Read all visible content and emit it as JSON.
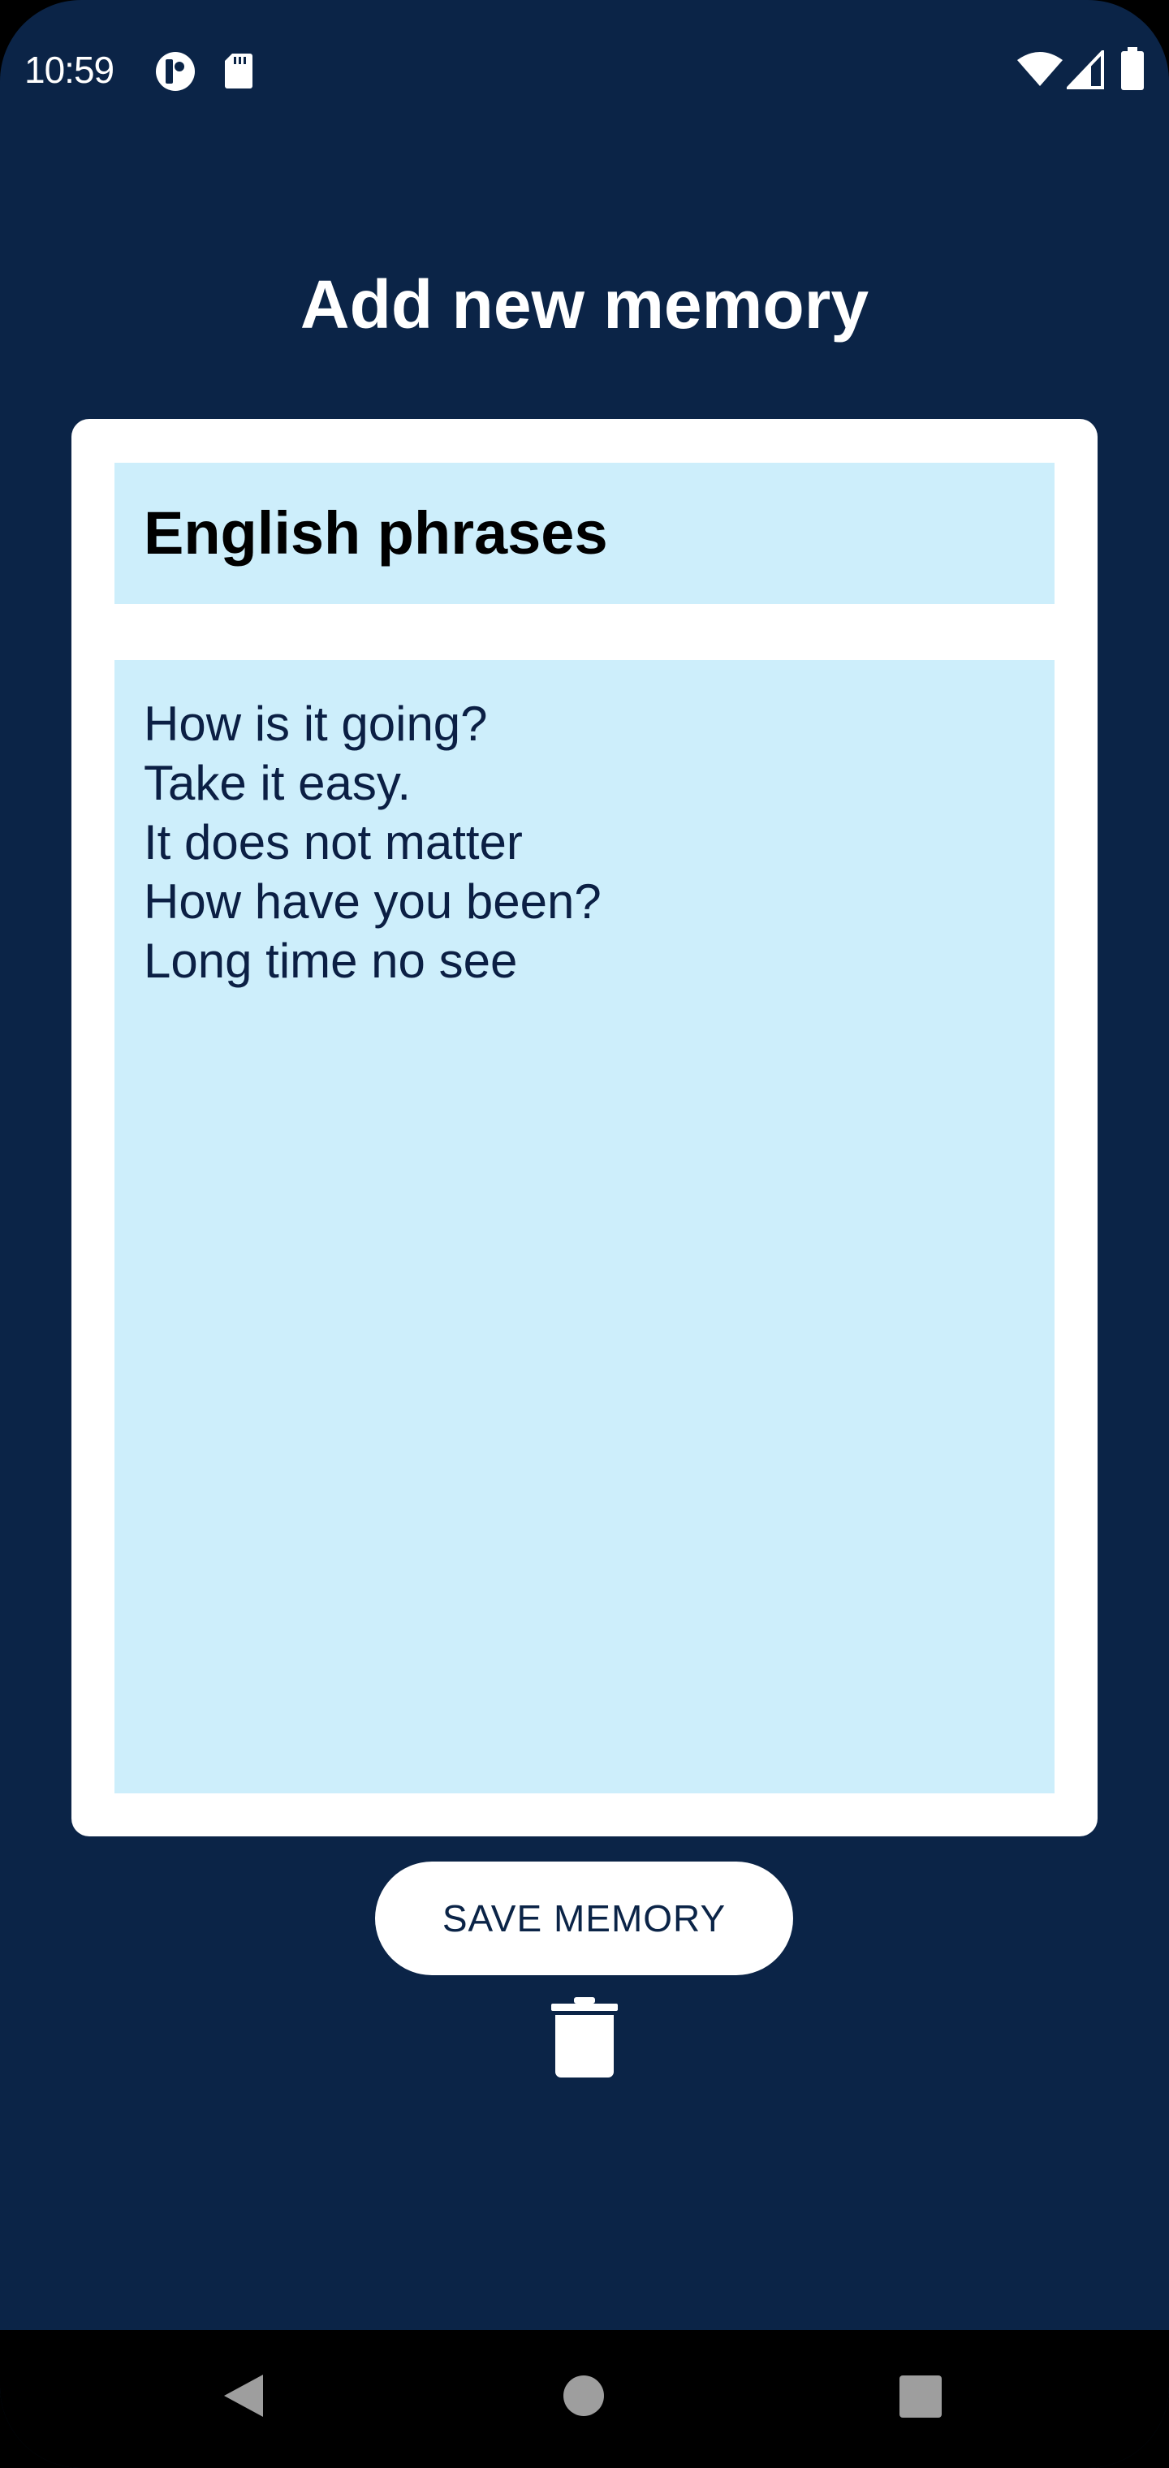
{
  "status_bar": {
    "time": "10:59",
    "left_icons": [
      "app-indicator-icon",
      "sd-card-icon"
    ],
    "right_icons": [
      "wifi-icon",
      "cell-signal-icon",
      "battery-icon"
    ]
  },
  "page": {
    "title": "Add new memory"
  },
  "memory_form": {
    "title_value": "English phrases",
    "body_lines": [
      "How is it going?",
      "Take it easy.",
      "It does not matter",
      "How have you been?",
      "Long time no see"
    ]
  },
  "actions": {
    "save_label": "SAVE MEMORY",
    "delete_icon": "trash-icon"
  },
  "nav_bar": {
    "buttons": [
      "back-icon",
      "home-icon",
      "recents-icon"
    ]
  },
  "colors": {
    "background": "#0b2447",
    "field_background": "#cdeefb",
    "card": "#ffffff",
    "nav_bar": "#000000"
  }
}
